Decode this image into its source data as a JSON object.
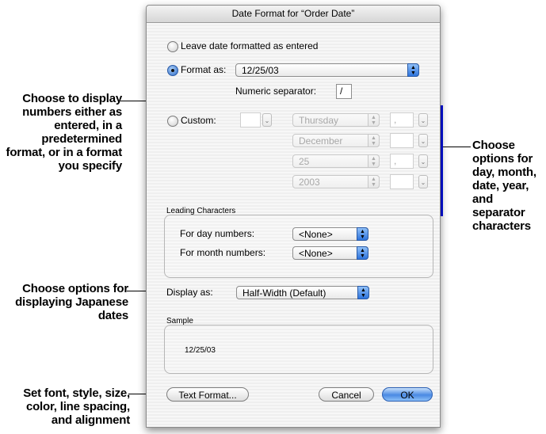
{
  "dialog": {
    "title": "Date Format for “Order Date”",
    "leave_label": "Leave date formatted as entered",
    "format_as_label": "Format as:",
    "format_as_value": "12/25/03",
    "numeric_separator_label": "Numeric separator:",
    "numeric_separator_value": "/",
    "custom_label": "Custom:",
    "custom_rows": [
      {
        "popup": "Thursday",
        "sep": ","
      },
      {
        "popup": "December",
        "sep": ""
      },
      {
        "popup": "25",
        "sep": ","
      },
      {
        "popup": "2003",
        "sep": ""
      }
    ],
    "leading_title": "Leading Characters",
    "day_label": "For day numbers:",
    "day_value": "<None>",
    "month_label": "For month numbers:",
    "month_value": "<None>",
    "display_as_label": "Display as:",
    "display_as_value": "Half-Width (Default)",
    "sample_title": "Sample",
    "sample_value": "12/25/03",
    "text_format_button": "Text Format...",
    "cancel_button": "Cancel",
    "ok_button": "OK",
    "selected_option": "format_as"
  },
  "callouts": {
    "display_numbers": "Choose to display numbers either as entered, in a predetermined format, or in a format you specify",
    "options_for": "Choose options for day, month, date, year, and separator characters",
    "japanese": "Choose options for displaying Japanese dates",
    "set_font": "Set font, style, size, color, line spacing, and alignment"
  },
  "colors": {
    "annotation_bar": "#0010e0",
    "default_button": "#4a8ae3"
  }
}
